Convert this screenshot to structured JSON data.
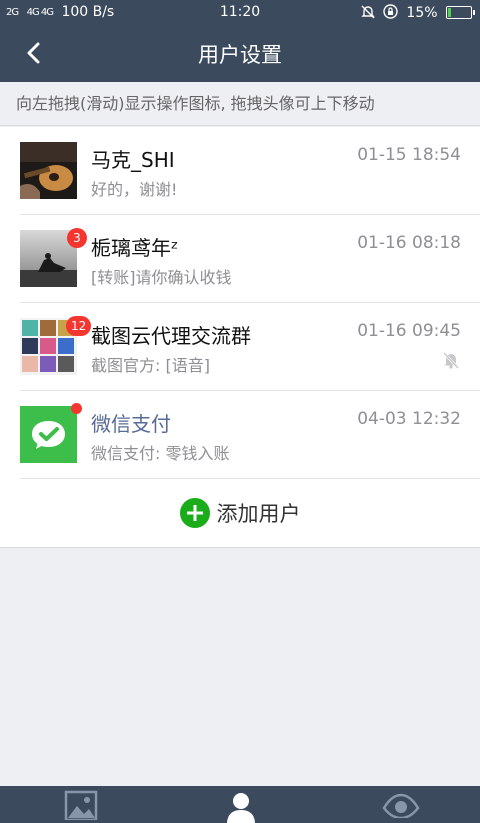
{
  "status_bar": {
    "signal_left": "2G",
    "signal_right": "4G 4G",
    "network_speed": "100 B/s",
    "time": "11:20",
    "battery_percent": "15%",
    "battery_level": 0.15,
    "icons": [
      "alarm-off-icon",
      "lock-rotation-icon",
      "battery-icon"
    ]
  },
  "nav": {
    "title": "用户设置",
    "back_icon": "back-arrow-icon"
  },
  "hint": "向左拖拽(滑动)显示操作图标, 拖拽头像可上下移动",
  "users": [
    {
      "name": "马克_SHI",
      "message": "好的，谢谢!",
      "time": "01-15 18:54"
    },
    {
      "name": "栀璃鸢年ᶻ",
      "message": "[转账]请你确认收钱",
      "time": "01-16 08:18",
      "badge": "3"
    },
    {
      "name": "截图云代理交流群",
      "message": "截图官方: [语音]",
      "time": "01-16 09:45",
      "badge": "12",
      "muted": true
    },
    {
      "name": "微信支付",
      "message": "微信支付: 零钱入账",
      "time": "04-03 12:32",
      "unread_dot": true
    }
  ],
  "add_user": {
    "label": "添加用户",
    "icon": "plus-circle-icon"
  },
  "tabbar": {
    "tabs": [
      "image-icon",
      "person-icon",
      "eye-icon"
    ]
  },
  "colors": {
    "header": "#3b4b5d",
    "badge": "#f43530",
    "add_green": "#1aad19",
    "wechat_pay_green": "#3dbe4a",
    "pay_name_blue": "#576b95"
  }
}
